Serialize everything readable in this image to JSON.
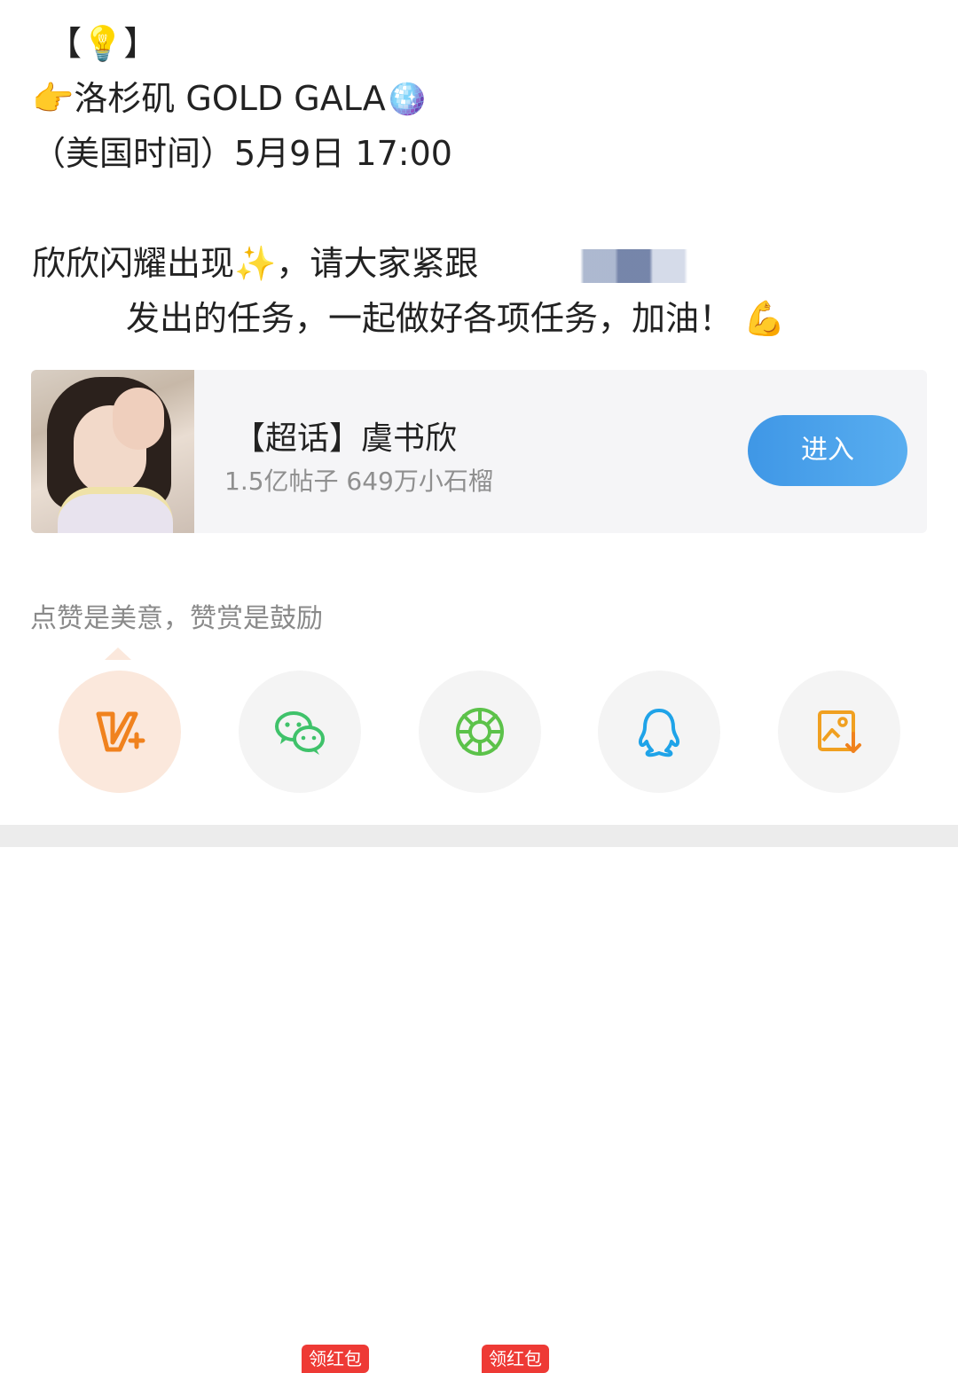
{
  "post": {
    "line1_open": "【",
    "line1_emoji": "💡",
    "line1_close": "】",
    "line2_emoji": "👉",
    "line2_text": "洛杉矶 GOLD GALA",
    "line2_emoji_end": "🪩",
    "line3_text": "（美国时间）5月9日 17:00",
    "line4_text": "欣欣闪耀出现",
    "line4_emoji": "✨",
    "line4_text2": "，请大家紧跟",
    "line5_text": "发出的任务，一起做好各项任务，加油！",
    "line5_emoji": "💪"
  },
  "topic_card": {
    "title": "【超话】虞书欣",
    "stats": "1.5亿帖子  649万小石榴",
    "enter_label": "进入"
  },
  "reward": {
    "text": "点赞是美意，赞赏是鼓励"
  },
  "share": {
    "items": [
      {
        "name": "weibo-v-plus",
        "badge": ""
      },
      {
        "name": "wechat",
        "badge": "领红包"
      },
      {
        "name": "moments",
        "badge": "领红包"
      },
      {
        "name": "qq",
        "badge": ""
      },
      {
        "name": "save-image",
        "badge": ""
      }
    ]
  },
  "colors": {
    "accent_blue": "#4aa3ec",
    "badge_red": "#ee3a35",
    "weibo_orange": "#f0821e",
    "wechat_green": "#3fc26a",
    "moments_green": "#5cc24a",
    "qq_blue": "#1fa3e8"
  }
}
